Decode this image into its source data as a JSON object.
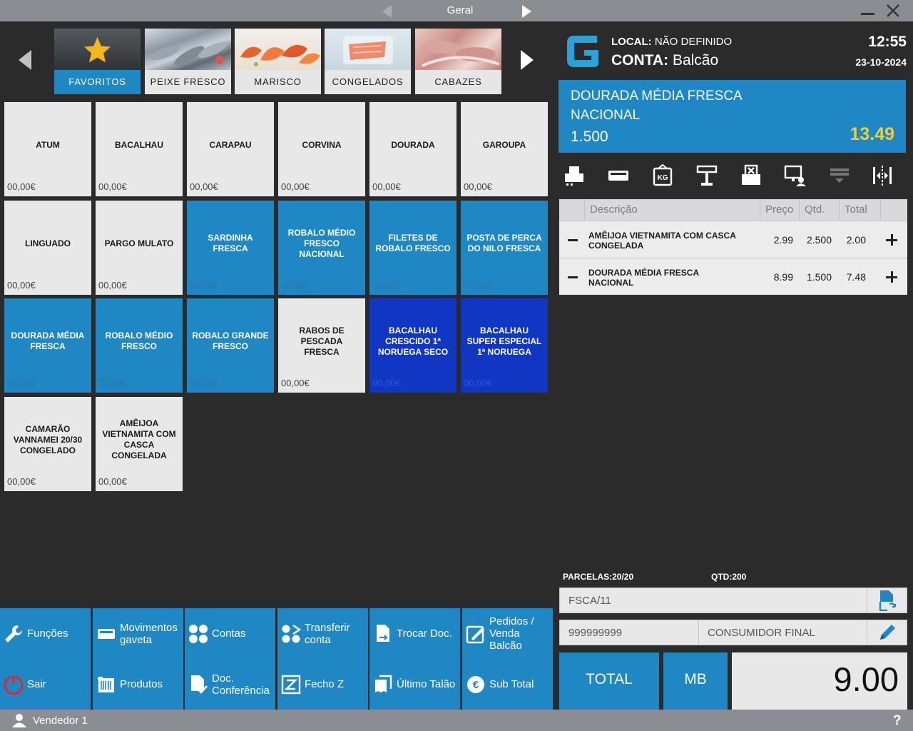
{
  "titlebar": {
    "title": "Geral"
  },
  "categories": [
    {
      "label": "FAVORITOS",
      "icon": "star-icon",
      "active": true
    },
    {
      "label": "PEIXE FRESCO",
      "icon": "fish-photo"
    },
    {
      "label": "MARISCO",
      "icon": "shrimp-photo"
    },
    {
      "label": "CONGELADOS",
      "icon": "frozen-fish-photo"
    },
    {
      "label": "CABAZES",
      "icon": "basket-photo"
    }
  ],
  "products": [
    {
      "name": "ATUM",
      "price": "00,00€",
      "style": "light"
    },
    {
      "name": "BACALHAU",
      "price": "00,00€",
      "style": "light"
    },
    {
      "name": "CARAPAU",
      "price": "00,00€",
      "style": "light"
    },
    {
      "name": "CORVINA",
      "price": "00,00€",
      "style": "light"
    },
    {
      "name": "DOURADA",
      "price": "00,00€",
      "style": "light"
    },
    {
      "name": "GAROUPA",
      "price": "00,00€",
      "style": "light"
    },
    {
      "name": "LINGUADO",
      "price": "00,00€",
      "style": "light"
    },
    {
      "name": "PARGO MULATO",
      "price": "00,00€",
      "style": "light"
    },
    {
      "name": "SARDINHA FRESCA",
      "price": "00,00€",
      "style": "blue"
    },
    {
      "name": "ROBALO MÉDIO FRESCO NACIONAL",
      "price": "00,00€",
      "style": "blue"
    },
    {
      "name": "FILETES DE ROBALO FRESCO",
      "price": "00,00€",
      "style": "blue"
    },
    {
      "name": "POSTA DE PERCA DO NILO FRESCA",
      "price": "00,00€",
      "style": "blue"
    },
    {
      "name": "DOURADA MÉDIA FRESCA",
      "price": "00,00€",
      "style": "blue"
    },
    {
      "name": "ROBALO MÉDIO FRESCO",
      "price": "00,00€",
      "style": "blue"
    },
    {
      "name": "ROBALO GRANDE FRESCO",
      "price": "00,00€",
      "style": "blue"
    },
    {
      "name": "RABOS DE PESCADA FRESCA",
      "price": "00,00€",
      "style": "light"
    },
    {
      "name": "BACALHAU CRESCIDO 1ª NORUEGA SECO",
      "price": "00,00€",
      "style": "dark"
    },
    {
      "name": "BACALHAU SUPER ESPECIAL 1ª NORUEGA",
      "price": "00,00€",
      "style": "dark"
    },
    {
      "name": "CAMARÃO VANNAMEI 20/30 CONGELADO",
      "price": "00,00€",
      "style": "light"
    },
    {
      "name": "AMÊIJOA VIETNAMITA COM CASCA CONGELADA",
      "price": "00,00€",
      "style": "light"
    }
  ],
  "functions": {
    "funcoes": "Funções",
    "movimentos": "Movimentos gaveta",
    "contas": "Contas",
    "transferir": "Transferir conta",
    "trocar": "Trocar Doc.",
    "pedidos": "Pedidos / Venda Balcão",
    "sair": "Sair",
    "produtos": "Produtos",
    "conferencia": "Doc. Conferência",
    "fecho": "Fecho Z",
    "ultimo": "Último Talão",
    "subtotal": "Sub Total"
  },
  "status": {
    "vendor": "Vendedor 1",
    "help": "?"
  },
  "header": {
    "local_label": "LOCAL:",
    "local_value": "NÃO DEFINIDO",
    "conta_label": "CONTA:",
    "conta_value": "Balcão",
    "time": "12:55",
    "date": "23-10-2024"
  },
  "selected_item": {
    "name": "DOURADA MÉDIA FRESCA NACIONAL",
    "qty": "1.500",
    "total": "13.49"
  },
  "toolbar_icons": [
    "printer-icon",
    "drawer-icon",
    "scale-kg-icon",
    "table-icon",
    "cancel-document-icon",
    "client-display-icon",
    "terminal-icon",
    "split-icon"
  ],
  "order": {
    "headers": {
      "descricao": "Descrição",
      "preco": "Preço",
      "qtd": "Qtd.",
      "total": "Total"
    },
    "rows": [
      {
        "desc": "AMÊIJOA VIETNAMITA COM CASCA CONGELADA",
        "preco": "2.99",
        "qtd": "2.500",
        "total": "2.00"
      },
      {
        "desc": "DOURADA MÉDIA FRESCA NACIONAL",
        "preco": "8.99",
        "qtd": "1.500",
        "total": "7.48"
      }
    ]
  },
  "summary": {
    "parcelas": "PARCELAS:20/20",
    "qtd": "QTD:200"
  },
  "document": {
    "code": "FSCA/11"
  },
  "customer": {
    "nif": "999999999",
    "name": "CONSUMIDOR FINAL"
  },
  "payment": {
    "total_label": "TOTAL",
    "method": "MB",
    "amount": "9.00"
  },
  "colors": {
    "accent": "#1f87c3",
    "dark_blue": "#1136c2",
    "highlight": "#f4cf2a",
    "bar_grey": "#8a8d91"
  }
}
